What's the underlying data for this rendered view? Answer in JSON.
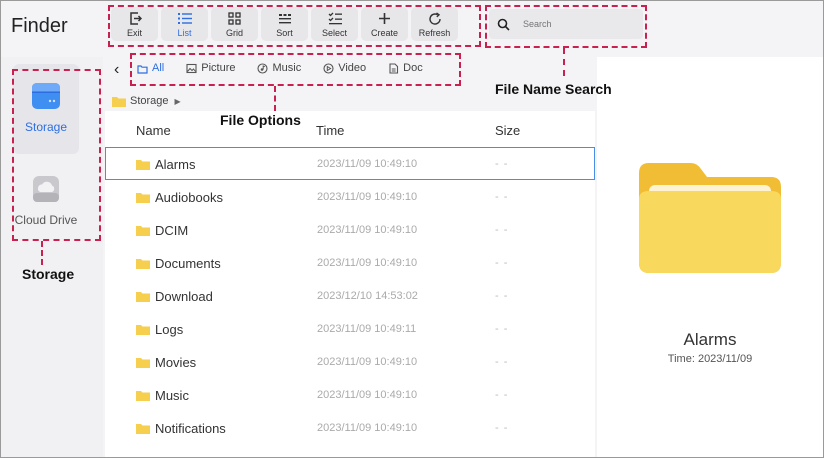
{
  "app": {
    "title": "Finder"
  },
  "toolbar": [
    {
      "label": "Exit",
      "icon": "exit-icon"
    },
    {
      "label": "List",
      "icon": "list-icon",
      "active": true
    },
    {
      "label": "Grid",
      "icon": "grid-icon"
    },
    {
      "label": "Sort",
      "icon": "sort-icon"
    },
    {
      "label": "Select",
      "icon": "select-icon"
    },
    {
      "label": "Create",
      "icon": "plus-icon"
    },
    {
      "label": "Refresh",
      "icon": "refresh-icon"
    }
  ],
  "search": {
    "placeholder": "Search"
  },
  "sidebar": {
    "items": [
      {
        "label": "Storage",
        "icon": "storage-icon",
        "selected": true
      },
      {
        "label": "Cloud Drive",
        "icon": "cloud-drive-icon",
        "selected": false
      }
    ]
  },
  "tabs": [
    {
      "label": "All",
      "icon": "all-icon",
      "active": true
    },
    {
      "label": "Picture",
      "icon": "picture-icon"
    },
    {
      "label": "Music",
      "icon": "music-icon"
    },
    {
      "label": "Video",
      "icon": "video-icon"
    },
    {
      "label": "Doc",
      "icon": "doc-icon"
    }
  ],
  "breadcrumb": {
    "current": "Storage"
  },
  "list": {
    "columns": {
      "name": "Name",
      "time": "Time",
      "size": "Size"
    },
    "rows": [
      {
        "name": "Alarms",
        "time": "2023/11/09 10:49:10",
        "size": "- -",
        "selected": true
      },
      {
        "name": "Audiobooks",
        "time": "2023/11/09 10:49:10",
        "size": "- -"
      },
      {
        "name": "DCIM",
        "time": "2023/11/09 10:49:10",
        "size": "- -"
      },
      {
        "name": "Documents",
        "time": "2023/11/09 10:49:10",
        "size": "- -"
      },
      {
        "name": "Download",
        "time": "2023/12/10 14:53:02",
        "size": "- -"
      },
      {
        "name": "Logs",
        "time": "2023/11/09 10:49:11",
        "size": "- -"
      },
      {
        "name": "Movies",
        "time": "2023/11/09 10:49:10",
        "size": "- -"
      },
      {
        "name": "Music",
        "time": "2023/11/09 10:49:10",
        "size": "- -"
      },
      {
        "name": "Notifications",
        "time": "2023/11/09 10:49:10",
        "size": "- -"
      }
    ]
  },
  "preview": {
    "name": "Alarms",
    "time": "Time: 2023/11/09"
  },
  "annotations": {
    "file_options": "File Options",
    "file_name_search": "File Name Search",
    "storage": "Storage"
  },
  "colors": {
    "accent": "#2d6ee0",
    "annotation": "#c8204f",
    "folder": "#f6cf4e"
  }
}
